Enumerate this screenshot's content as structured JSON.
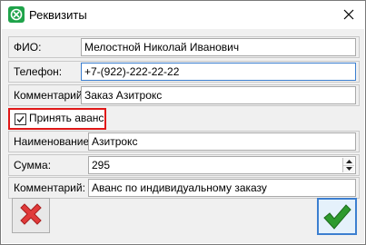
{
  "window": {
    "title": "Реквизиты",
    "close_glyph": "✕",
    "icon": "app-logo-icon"
  },
  "customer": {
    "fio_label": "ФИО:",
    "fio_value": "Мелостной Николай Иванович",
    "phone_label": "Телефон:",
    "phone_value": "+7-(922)-222-22-22",
    "comment_label": "Комментарий:",
    "comment_value": "Заказ Азитрокс"
  },
  "advance": {
    "checkbox_label": "Принять аванс",
    "checked": true,
    "name_label": "Наименование:",
    "name_value": "Азитрокс",
    "amount_label": "Сумма:",
    "amount_value": "295",
    "comment_label": "Комментарий:",
    "comment_value": "Аванс по индивидуальному заказу"
  },
  "buttons": {
    "cancel_icon": "red-x-icon",
    "ok_icon": "green-check-icon"
  },
  "colors": {
    "highlight": "#e01818",
    "focus": "#3c7fd0",
    "ok_green": "#2e9a2e",
    "cancel_red": "#e03a3a",
    "app_icon_green": "#1fa34a"
  }
}
